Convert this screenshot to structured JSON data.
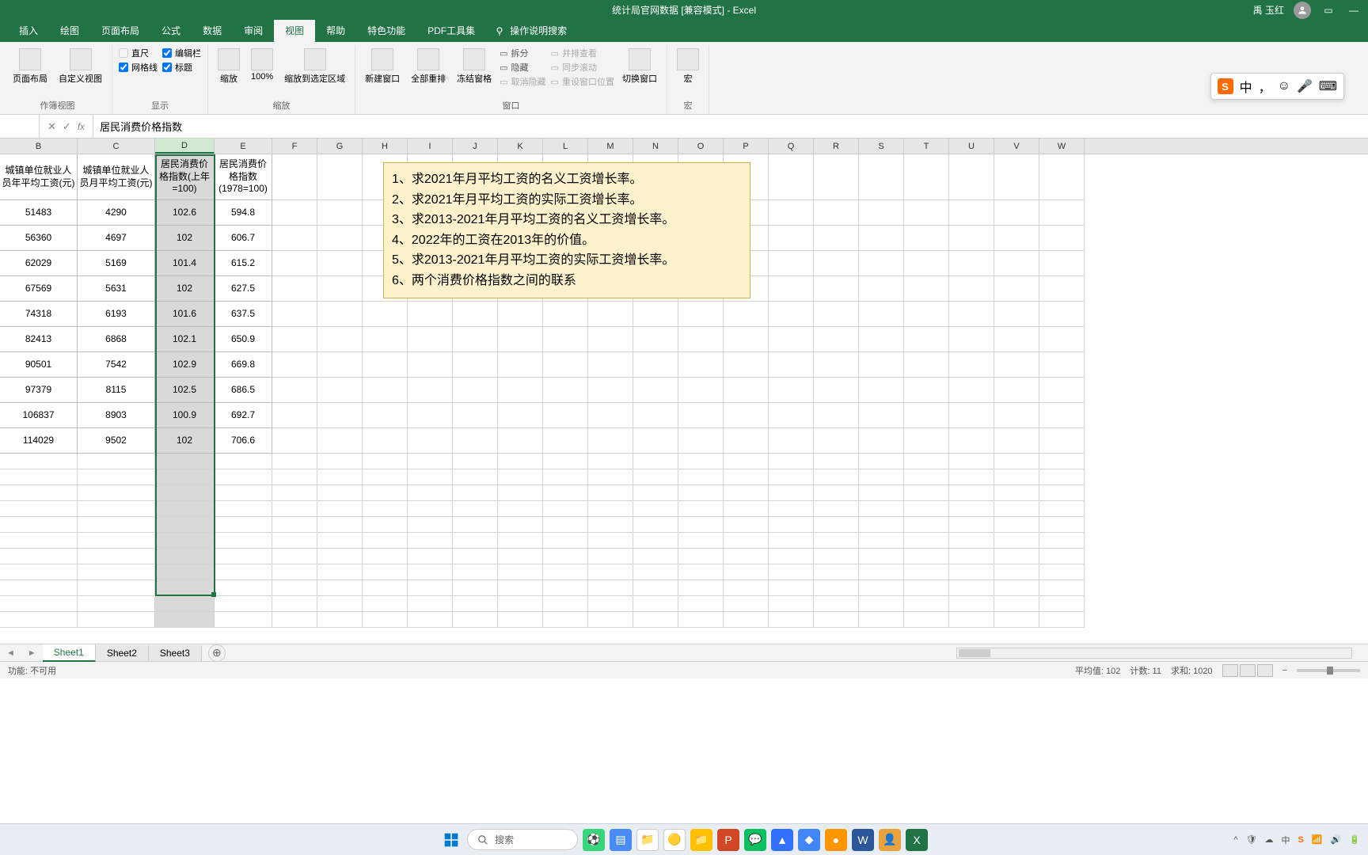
{
  "title": "统计局官网数据 [兼容模式] - Excel",
  "user": "禹 玉红",
  "tabs": [
    "插入",
    "绘图",
    "页面布局",
    "公式",
    "数据",
    "审阅",
    "视图",
    "帮助",
    "特色功能",
    "PDF工具集"
  ],
  "active_tab": "视图",
  "tell_me": "操作说明搜索",
  "ribbon": {
    "workbook_views": {
      "label": "作簿视图",
      "items": [
        "页面布局",
        "自定义视图"
      ]
    },
    "show": {
      "label": "显示",
      "ruler": "直尺",
      "formula_bar": "编辑栏",
      "gridlines": "网格线",
      "headings": "标题"
    },
    "zoom": {
      "label": "缩放",
      "zoom": "缩放",
      "hundred": "100%",
      "selection": "缩放到选定区域"
    },
    "window": {
      "label": "窗口",
      "new": "新建窗口",
      "arrange": "全部重排",
      "freeze": "冻结窗格",
      "split": "拆分",
      "hide": "隐藏",
      "unhide": "取消隐藏",
      "side": "并排查看",
      "sync": "同步滚动",
      "reset": "重设窗口位置",
      "switch": "切换窗口"
    },
    "macros": {
      "label": "宏",
      "btn": "宏"
    }
  },
  "formula_bar_value": "居民消费价格指数",
  "ime_label": "中",
  "col_letters": [
    "B",
    "C",
    "D",
    "E",
    "F",
    "G",
    "H",
    "I",
    "J",
    "K",
    "L",
    "M",
    "N",
    "O",
    "P",
    "Q",
    "R",
    "S",
    "T",
    "U",
    "V",
    "W"
  ],
  "col_widths": {
    "B": 98,
    "C": 98,
    "D": 75,
    "E": 73
  },
  "headers": {
    "B": "城镇单位就业人员年平均工资(元)",
    "C": "城镇单位就业人员月平均工资(元)",
    "D": "居民消费价格指数(上年=100)",
    "E": "居民消费价格指数(1978=100)"
  },
  "rows": [
    {
      "B": "51483",
      "C": "4290",
      "D": "102.6",
      "E": "594.8"
    },
    {
      "B": "56360",
      "C": "4697",
      "D": "102",
      "E": "606.7"
    },
    {
      "B": "62029",
      "C": "5169",
      "D": "101.4",
      "E": "615.2"
    },
    {
      "B": "67569",
      "C": "5631",
      "D": "102",
      "E": "627.5"
    },
    {
      "B": "74318",
      "C": "6193",
      "D": "101.6",
      "E": "637.5"
    },
    {
      "B": "82413",
      "C": "6868",
      "D": "102.1",
      "E": "650.9"
    },
    {
      "B": "90501",
      "C": "7542",
      "D": "102.9",
      "E": "669.8"
    },
    {
      "B": "97379",
      "C": "8115",
      "D": "102.5",
      "E": "686.5"
    },
    {
      "B": "106837",
      "C": "8903",
      "D": "100.9",
      "E": "692.7"
    },
    {
      "B": "114029",
      "C": "9502",
      "D": "102",
      "E": "706.6"
    }
  ],
  "note_lines": [
    "1、求2021年月平均工资的名义工资增长率。",
    "2、求2021年月平均工资的实际工资增长率。",
    "3、求2013-2021年月平均工资的名义工资增长率。",
    "4、2022年的工资在2013年的价值。",
    "5、求2013-2021年月平均工资的实际工资增长率。",
    "6、两个消费价格指数之间的联系"
  ],
  "sheets": [
    "Sheet1",
    "Sheet2",
    "Sheet3"
  ],
  "active_sheet": "Sheet1",
  "status_left": "功能: 不可用",
  "status_stats": {
    "avg_label": "平均值:",
    "avg": "102",
    "count_label": "计数:",
    "count": "11",
    "sum_label": "求和:",
    "sum": "1020"
  },
  "taskbar": {
    "search": "搜索"
  },
  "chart_data": {
    "type": "table",
    "columns": [
      "城镇单位就业人员年平均工资(元)",
      "城镇单位就业人员月平均工资(元)",
      "居民消费价格指数(上年=100)",
      "居民消费价格指数(1978=100)"
    ],
    "data": [
      [
        51483,
        4290,
        102.6,
        594.8
      ],
      [
        56360,
        4697,
        102,
        606.7
      ],
      [
        62029,
        5169,
        101.4,
        615.2
      ],
      [
        67569,
        5631,
        102,
        627.5
      ],
      [
        74318,
        6193,
        101.6,
        637.5
      ],
      [
        82413,
        6868,
        102.1,
        650.9
      ],
      [
        90501,
        7542,
        102.9,
        669.8
      ],
      [
        97379,
        8115,
        102.5,
        686.5
      ],
      [
        106837,
        8903,
        100.9,
        692.7
      ],
      [
        114029,
        9502,
        102,
        706.6
      ]
    ]
  }
}
